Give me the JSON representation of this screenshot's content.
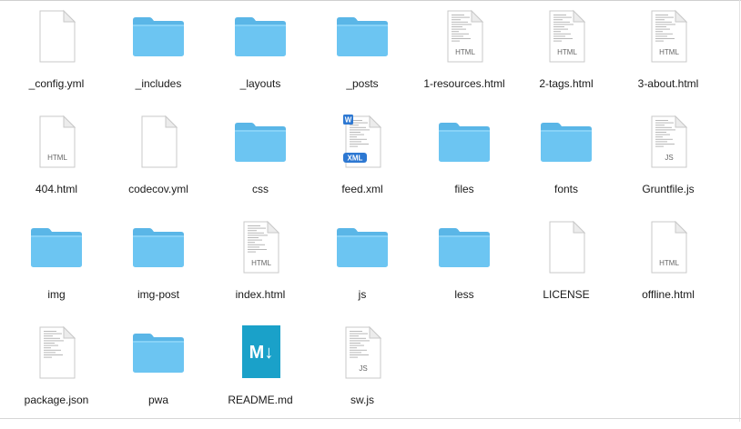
{
  "window": {
    "view": "icon-view"
  },
  "colors": {
    "folder": "#6cc5f2",
    "folder_tab": "#5ab6e7",
    "page": "#ffffff",
    "page_border": "#c9c9c9",
    "markdown": "#1aa1c9"
  },
  "files": [
    {
      "name": "_config.yml",
      "kind": "doc"
    },
    {
      "name": "_includes",
      "kind": "folder"
    },
    {
      "name": "_layouts",
      "kind": "folder"
    },
    {
      "name": "_posts",
      "kind": "folder"
    },
    {
      "name": "1-resources.html",
      "kind": "code",
      "badge": "HTML"
    },
    {
      "name": "2-tags.html",
      "kind": "code",
      "badge": "HTML"
    },
    {
      "name": "3-about.html",
      "kind": "code",
      "badge": "HTML"
    },
    {
      "name": "404.html",
      "kind": "doc",
      "badge": "HTML"
    },
    {
      "name": "codecov.yml",
      "kind": "doc"
    },
    {
      "name": "css",
      "kind": "folder"
    },
    {
      "name": "feed.xml",
      "kind": "xml",
      "badge": "XML",
      "corner": "W"
    },
    {
      "name": "files",
      "kind": "folder"
    },
    {
      "name": "fonts",
      "kind": "folder"
    },
    {
      "name": "Gruntfile.js",
      "kind": "code",
      "badge": "JS"
    },
    {
      "name": "img",
      "kind": "folder"
    },
    {
      "name": "img-post",
      "kind": "folder"
    },
    {
      "name": "index.html",
      "kind": "code",
      "badge": "HTML"
    },
    {
      "name": "js",
      "kind": "folder"
    },
    {
      "name": "less",
      "kind": "folder"
    },
    {
      "name": "LICENSE",
      "kind": "doc"
    },
    {
      "name": "offline.html",
      "kind": "doc",
      "badge": "HTML"
    },
    {
      "name": "package.json",
      "kind": "code"
    },
    {
      "name": "pwa",
      "kind": "folder"
    },
    {
      "name": "README.md",
      "kind": "markdown",
      "glyph": "M↓"
    },
    {
      "name": "sw.js",
      "kind": "code",
      "badge": "JS"
    }
  ]
}
